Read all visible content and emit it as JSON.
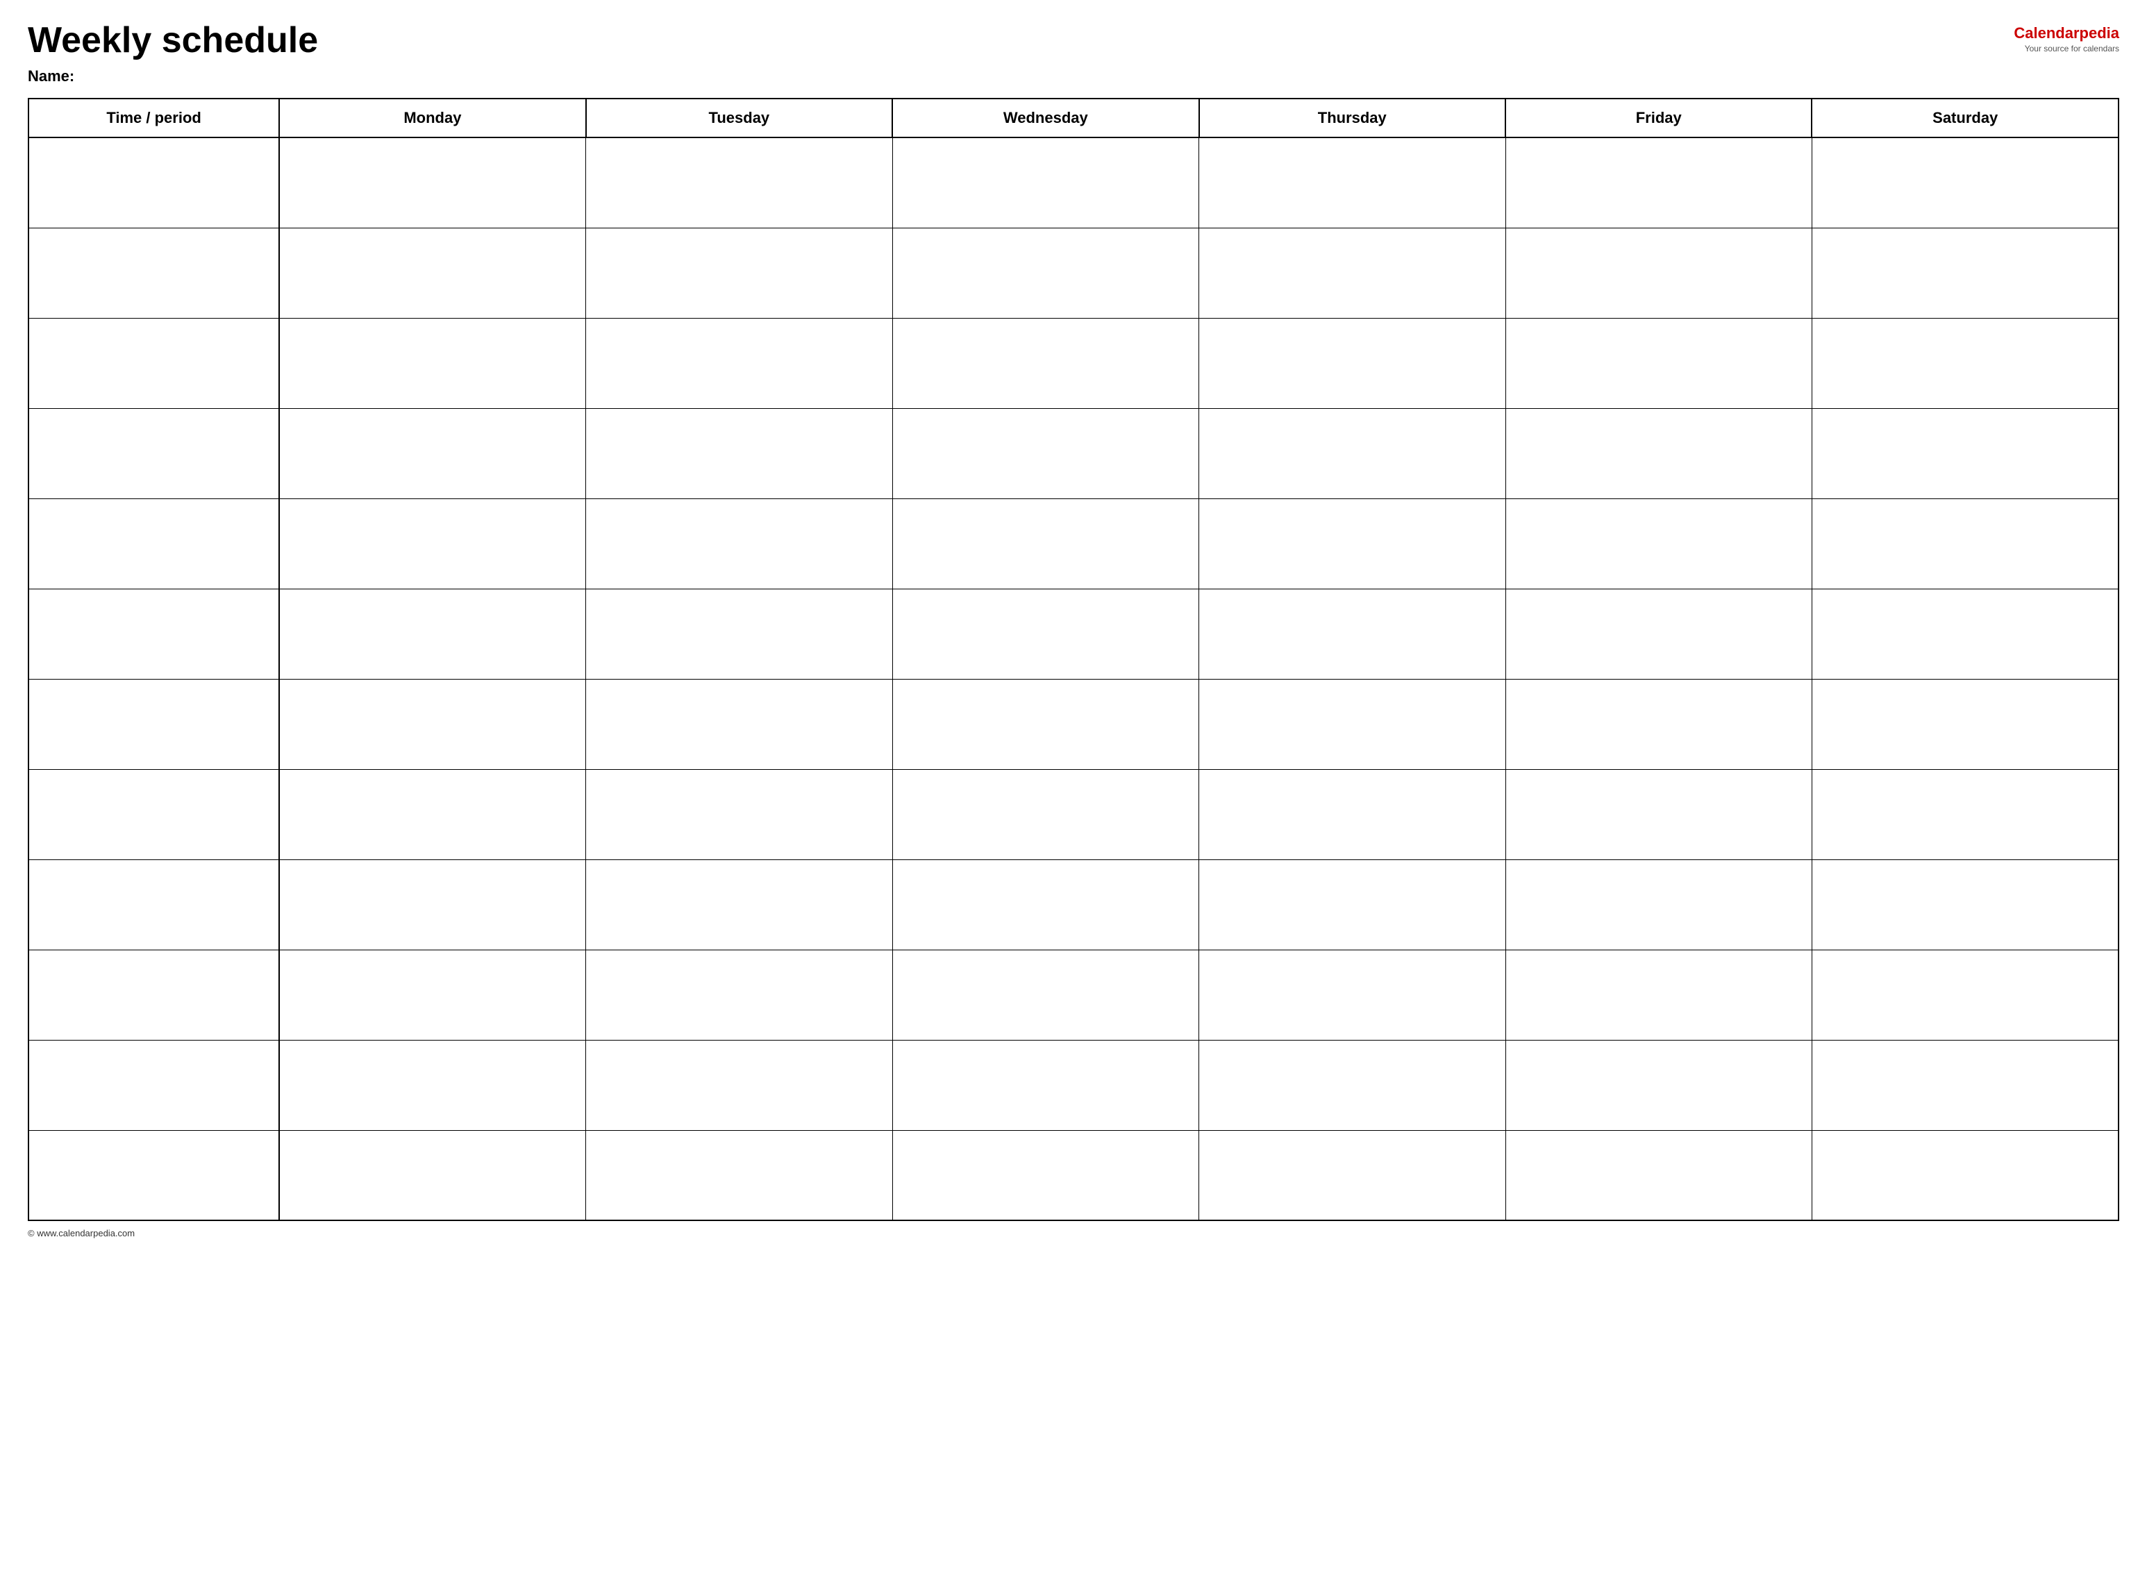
{
  "header": {
    "title": "Weekly schedule",
    "logo": {
      "text_black": "Calendar",
      "text_red": "pedia",
      "subtitle": "Your source for calendars"
    },
    "name_label": "Name:"
  },
  "table": {
    "columns": [
      {
        "key": "time",
        "label": "Time / period"
      },
      {
        "key": "monday",
        "label": "Monday"
      },
      {
        "key": "tuesday",
        "label": "Tuesday"
      },
      {
        "key": "wednesday",
        "label": "Wednesday"
      },
      {
        "key": "thursday",
        "label": "Thursday"
      },
      {
        "key": "friday",
        "label": "Friday"
      },
      {
        "key": "saturday",
        "label": "Saturday"
      }
    ],
    "row_count": 12
  },
  "footer": {
    "url": "© www.calendarpedia.com"
  }
}
